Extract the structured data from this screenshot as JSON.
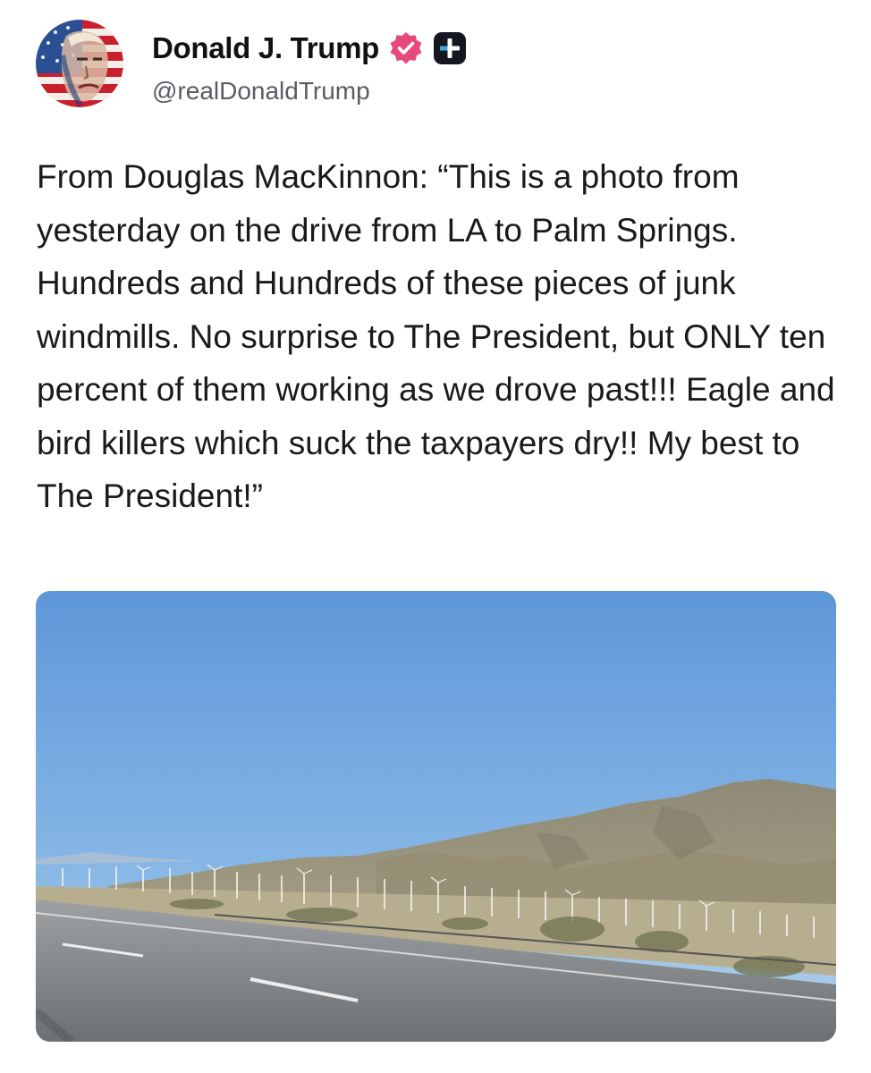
{
  "author": {
    "display_name": "Donald J. Trump",
    "handle": "@realDonaldTrump",
    "verified_badge_color": "#e64a79"
  },
  "post": {
    "text": "From Douglas MacKinnon: “This is a photo from yesterday on the drive from LA to Palm Springs. Hundreds and Hundreds of these pieces of junk windmills. No surprise to The President, but ONLY ten percent of them working as we drove past!!! Eagle and bird killers which suck the taxpayers dry!! My best to The President!”"
  },
  "icons": {
    "verified": "verified-badge-icon",
    "follow": "plus-icon"
  }
}
